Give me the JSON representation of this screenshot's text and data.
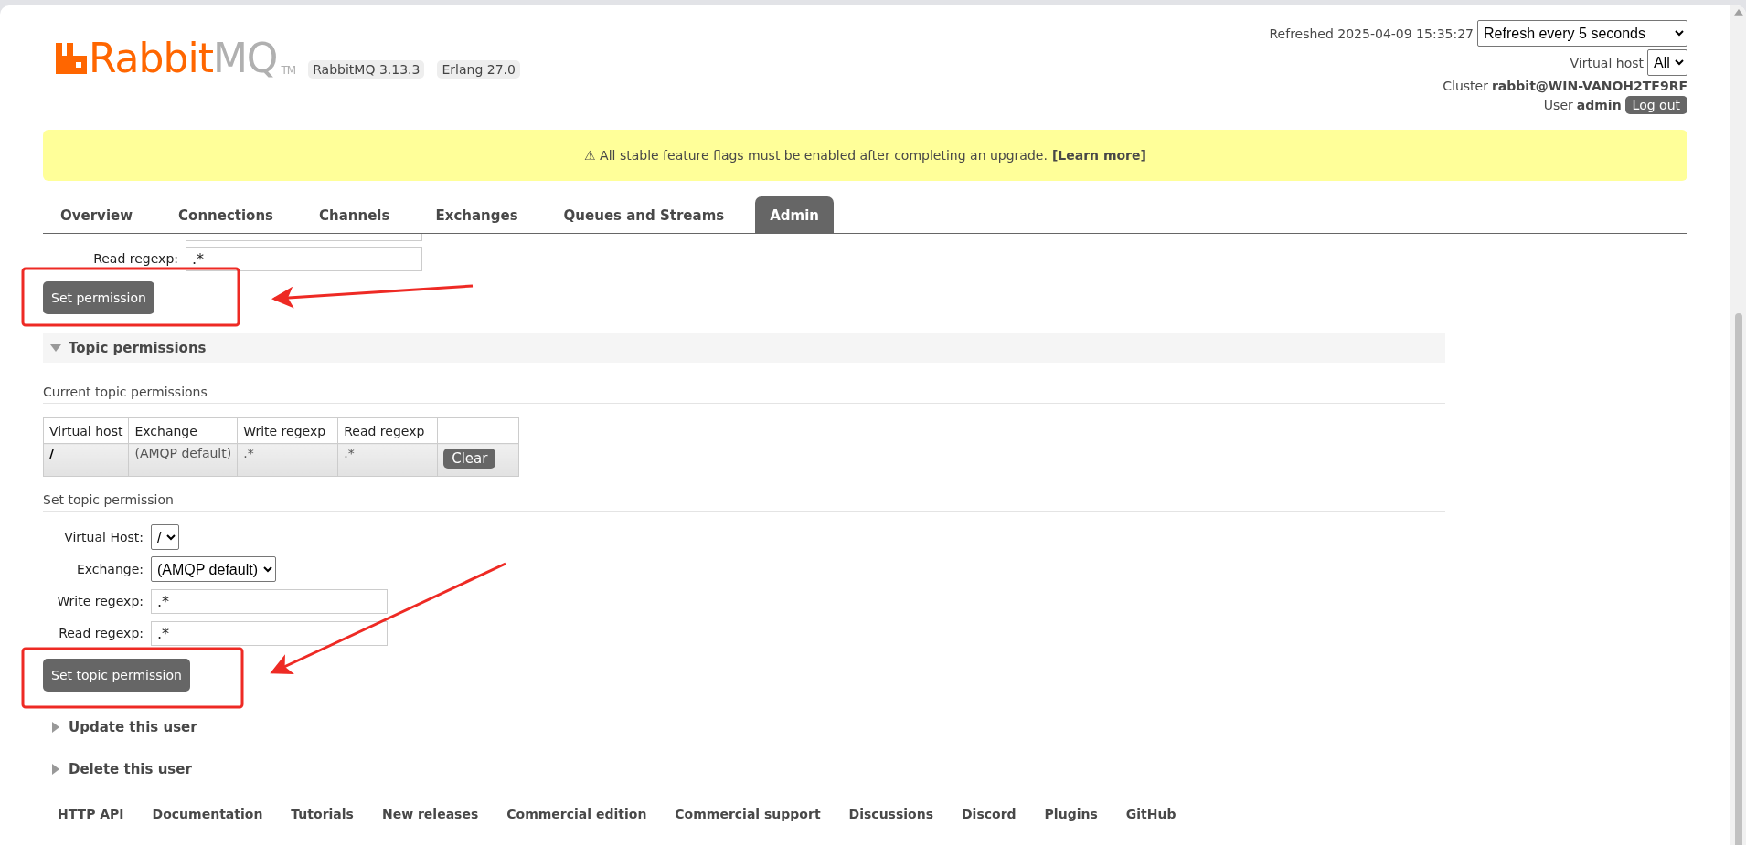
{
  "header": {
    "logo": {
      "brand": "Rabbit",
      "suffix": "MQ",
      "tm": "TM"
    },
    "versions": [
      "RabbitMQ 3.13.3",
      "Erlang 27.0"
    ],
    "refreshed": "Refreshed 2025-04-09 15:35:27",
    "refresh_select": "Refresh every 5 seconds",
    "vhost_label": "Virtual host",
    "vhost_select": "All",
    "cluster_label": "Cluster",
    "cluster": "rabbit@WIN-VANOH2TF9RF",
    "user_label": "User",
    "user": "admin",
    "logout": "Log out"
  },
  "banner": {
    "text": "⚠ All stable feature flags must be enabled after completing an upgrade.",
    "link": "[Learn more]"
  },
  "tabs": [
    {
      "label": "Overview",
      "selected": false
    },
    {
      "label": "Connections",
      "selected": false
    },
    {
      "label": "Channels",
      "selected": false
    },
    {
      "label": "Exchanges",
      "selected": false
    },
    {
      "label": "Queues and Streams",
      "selected": false
    },
    {
      "label": "Admin",
      "selected": true
    }
  ],
  "permission_form": {
    "read_label": "Read regexp:",
    "read_value": ".*",
    "button": "Set permission"
  },
  "topic_section": {
    "title": "Topic permissions",
    "expanded": true,
    "current_heading": "Current topic permissions",
    "table": {
      "columns": [
        "Virtual host",
        "Exchange",
        "Write regexp",
        "Read regexp"
      ],
      "rows": [
        {
          "vhost": "/",
          "exchange": "(AMQP default)",
          "write": ".*",
          "read": ".*",
          "action": "Clear"
        }
      ]
    },
    "set_heading": "Set topic permission",
    "fields": [
      {
        "kind": "select",
        "label": "Virtual Host:",
        "value": "/"
      },
      {
        "kind": "select",
        "label": "Exchange:",
        "value": "(AMQP default)"
      },
      {
        "kind": "text",
        "label": "Write regexp:",
        "value": ".*"
      },
      {
        "kind": "text",
        "label": "Read regexp:",
        "value": ".*"
      }
    ],
    "button": "Set topic permission"
  },
  "collapsed_sections": [
    {
      "title": "Update this user",
      "expanded": false
    },
    {
      "title": "Delete this user",
      "expanded": false
    }
  ],
  "footer_links": [
    "HTTP API",
    "Documentation",
    "Tutorials",
    "New releases",
    "Commercial edition",
    "Commercial support",
    "Discussions",
    "Discord",
    "Plugins",
    "GitHub"
  ]
}
